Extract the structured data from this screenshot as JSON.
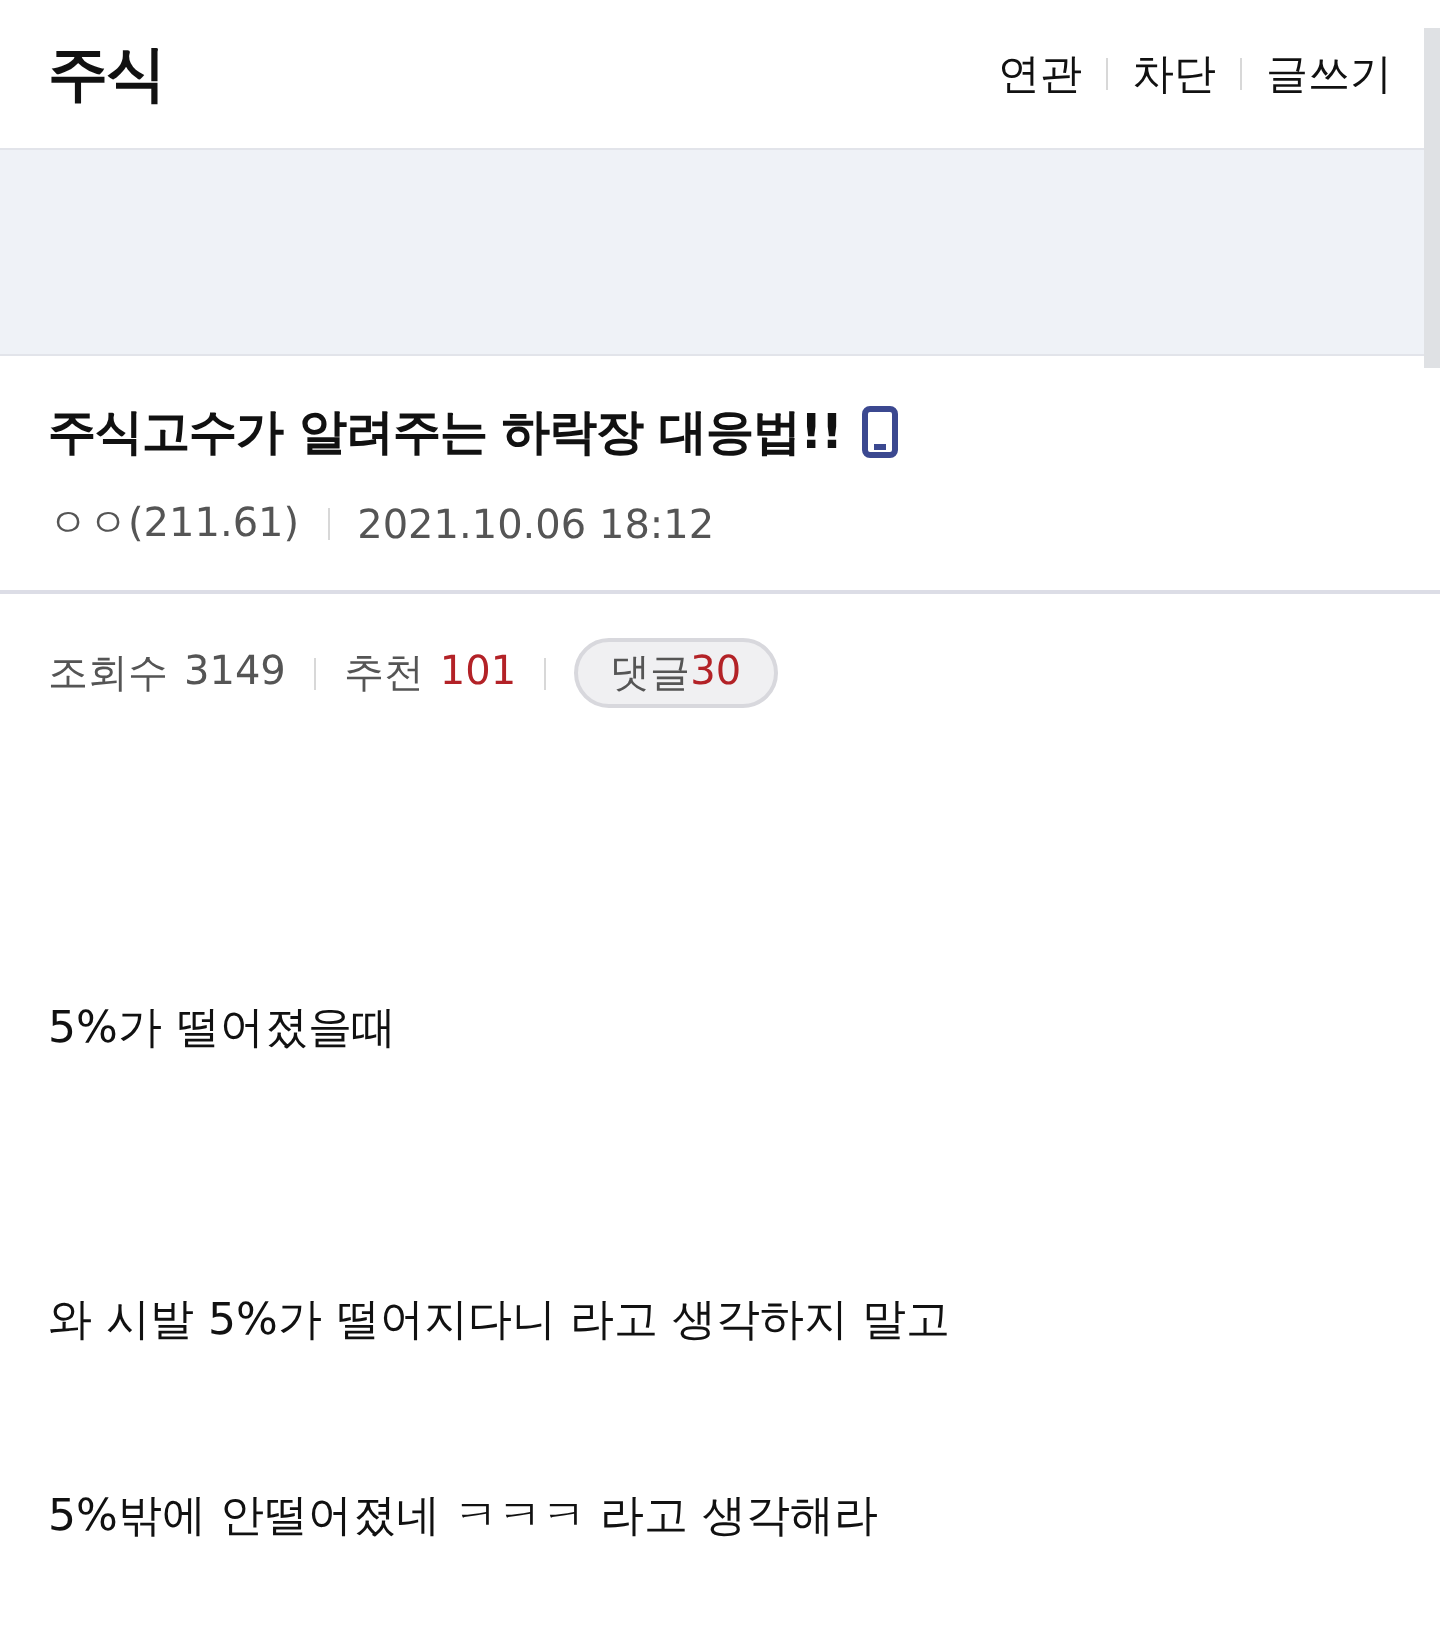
{
  "header": {
    "title": "주식",
    "actions": [
      "연관",
      "차단",
      "글쓰기"
    ]
  },
  "post": {
    "title": "주식고수가 알려주는 하락장 대응법!!",
    "mobile": true,
    "author": "ㅇㅇ(211.61)",
    "date": "2021.10.06 18:12",
    "views_label": "조회수",
    "views": "3149",
    "likes_label": "추천",
    "likes": "101",
    "comments_label": "댓글",
    "comments": "30"
  },
  "body": [
    {
      "kind": "gap"
    },
    {
      "kind": "gap"
    },
    {
      "kind": "text",
      "text": "5%가 떨어졌을때"
    },
    {
      "kind": "gap"
    },
    {
      "kind": "gap"
    },
    {
      "kind": "text",
      "text": "와 시발 5%가 떨어지다니 라고 생각하지 말고"
    },
    {
      "kind": "gap"
    },
    {
      "kind": "text",
      "text": "5%밖에 안떨어졌네 ㅋㅋㅋ 라고 생각해라"
    }
  ]
}
